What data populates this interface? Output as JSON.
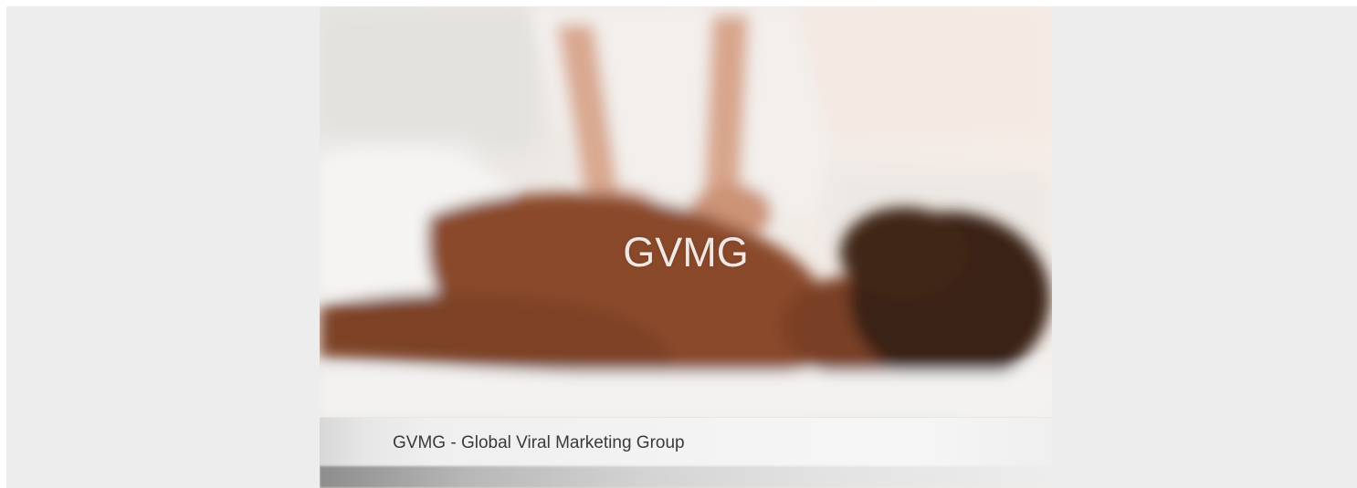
{
  "hero": {
    "title": "GVMG",
    "caption": "GVMG - Global Viral Marketing Group",
    "image": "blurred-massage-photo"
  },
  "colors": {
    "background": "#ededed",
    "skin": "#8a4a2a",
    "hair": "#3a2418",
    "towel": "#f4f1ee"
  }
}
